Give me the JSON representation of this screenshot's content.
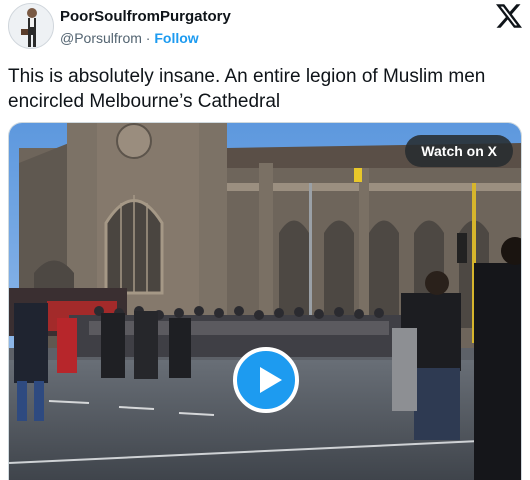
{
  "author": {
    "display_name": "PoorSoulfromPurgatory",
    "handle": "@Porsulfrom",
    "separator": "·",
    "follow_label": "Follow"
  },
  "tweet": {
    "text": "This is absolutely insane. An entire legion of Muslim men encircled Melbourne’s Cathedral"
  },
  "media": {
    "watch_label": "Watch on X"
  },
  "colors": {
    "accent": "#1d9bf0",
    "text": "#0f1419",
    "secondary_text": "#536471"
  },
  "icons": [
    "x-logo-icon",
    "play-icon"
  ]
}
